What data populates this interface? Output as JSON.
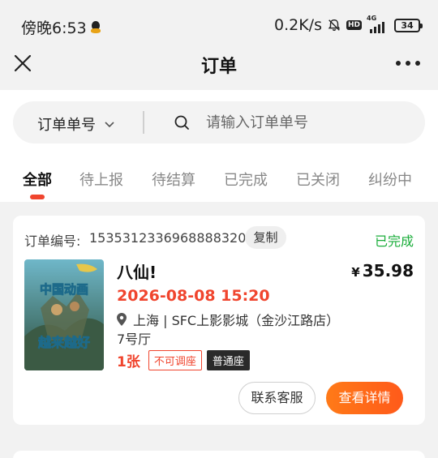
{
  "status_bar": {
    "time": "傍晚6:53",
    "net_speed": "0.2K/s",
    "hd_label": "HD",
    "network_type": "4G",
    "battery": "34"
  },
  "nav": {
    "title": "订单"
  },
  "search": {
    "type_label": "订单单号",
    "placeholder": "请输入订单单号"
  },
  "tabs": [
    {
      "label": "全部",
      "active": true
    },
    {
      "label": "待上报",
      "active": false
    },
    {
      "label": "待结算",
      "active": false
    },
    {
      "label": "已完成",
      "active": false
    },
    {
      "label": "已关闭",
      "active": false
    },
    {
      "label": "纠纷中",
      "active": false
    }
  ],
  "order": {
    "order_no_label": "订单编号:",
    "order_no": "1535312336968888320",
    "copy_label": "复制",
    "status": "已完成",
    "movie_title": "八仙!",
    "currency": "¥",
    "price": "35.98",
    "showtime": "2026-08-08 15:20",
    "location": "上海 | SFC上影影城（金沙江路店）",
    "hall": "7号厅",
    "ticket_count": "1张",
    "tag_no_adjust": "不可调座",
    "tag_seat_type": "普通座",
    "contact_label": "联系客服",
    "detail_label": "查看详情",
    "poster": {
      "line1": "中国动画",
      "line2": "越来越好"
    }
  },
  "colors": {
    "accent_red": "#f0452e",
    "status_green": "#1aad3a",
    "button_orange": "#ff6a1a"
  }
}
